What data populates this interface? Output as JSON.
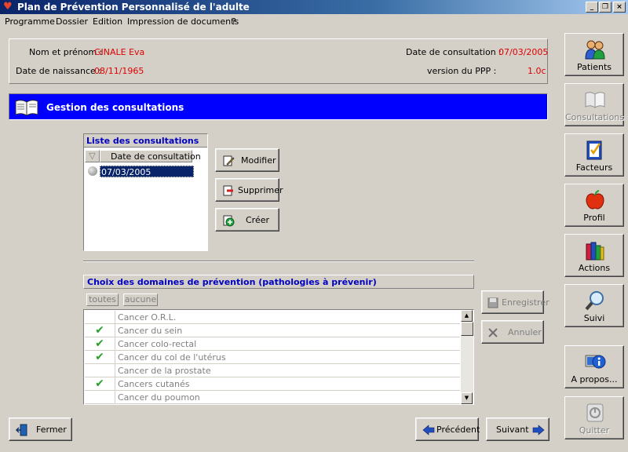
{
  "window": {
    "title": "Plan de Prévention Personnalisé de l'adulte",
    "controls": {
      "minimize": "_",
      "restore": "❐",
      "close": "×"
    }
  },
  "menu": [
    "Programme",
    "Dossier",
    "Edition",
    "Impression de documents",
    "?"
  ],
  "patient": {
    "name_label": "Nom et prénom :",
    "name": "GINALE Eva",
    "birth_label": "Date de naissance :",
    "birth": "08/11/1965",
    "consult_date_label": "Date de consultation :",
    "consult_date": "07/03/2005",
    "version_label": "version du PPP :",
    "version": "1.0c"
  },
  "section": {
    "title": "Gestion des consultations"
  },
  "consultations": {
    "title": "Liste des consultations",
    "column": "Date de consultation",
    "sort_glyph": "▽",
    "rows": [
      "07/03/2005"
    ]
  },
  "actions": {
    "modify": "Modifier",
    "delete": "Supprimer",
    "create": "Créer"
  },
  "domains": {
    "title": "Choix des domaines de prévention (pathologies à prévenir)",
    "all": "toutes",
    "none": "aucune",
    "items": [
      {
        "name": "Cancer O.R.L.",
        "checked": false
      },
      {
        "name": "Cancer du sein",
        "checked": true
      },
      {
        "name": "Cancer colo-rectal",
        "checked": true
      },
      {
        "name": "Cancer du col de l'utérus",
        "checked": true
      },
      {
        "name": "Cancer de la prostate",
        "checked": false
      },
      {
        "name": "Cancers cutanés",
        "checked": true
      },
      {
        "name": "Cancer du poumon",
        "checked": false
      }
    ],
    "check_glyph": "✔"
  },
  "form": {
    "save": "Enregistrer",
    "cancel": "Annuler"
  },
  "bottom": {
    "close": "Fermer",
    "previous": "Précédent",
    "next": "Suivant"
  },
  "sidebar": [
    {
      "label": "Patients",
      "enabled": true
    },
    {
      "label": "Consultations",
      "enabled": false
    },
    {
      "label": "Facteurs",
      "enabled": true
    },
    {
      "label": "Profil",
      "enabled": true
    },
    {
      "label": "Actions",
      "enabled": true
    },
    {
      "label": "Suivi",
      "enabled": true
    },
    {
      "label": "A propos...",
      "enabled": true
    },
    {
      "label": "Quitter",
      "enabled": false
    }
  ],
  "colors": {
    "accent_blue": "#0000ff",
    "label_red": "#e00000",
    "group_title": "#0000c0",
    "check_green": "#2aa02a"
  }
}
